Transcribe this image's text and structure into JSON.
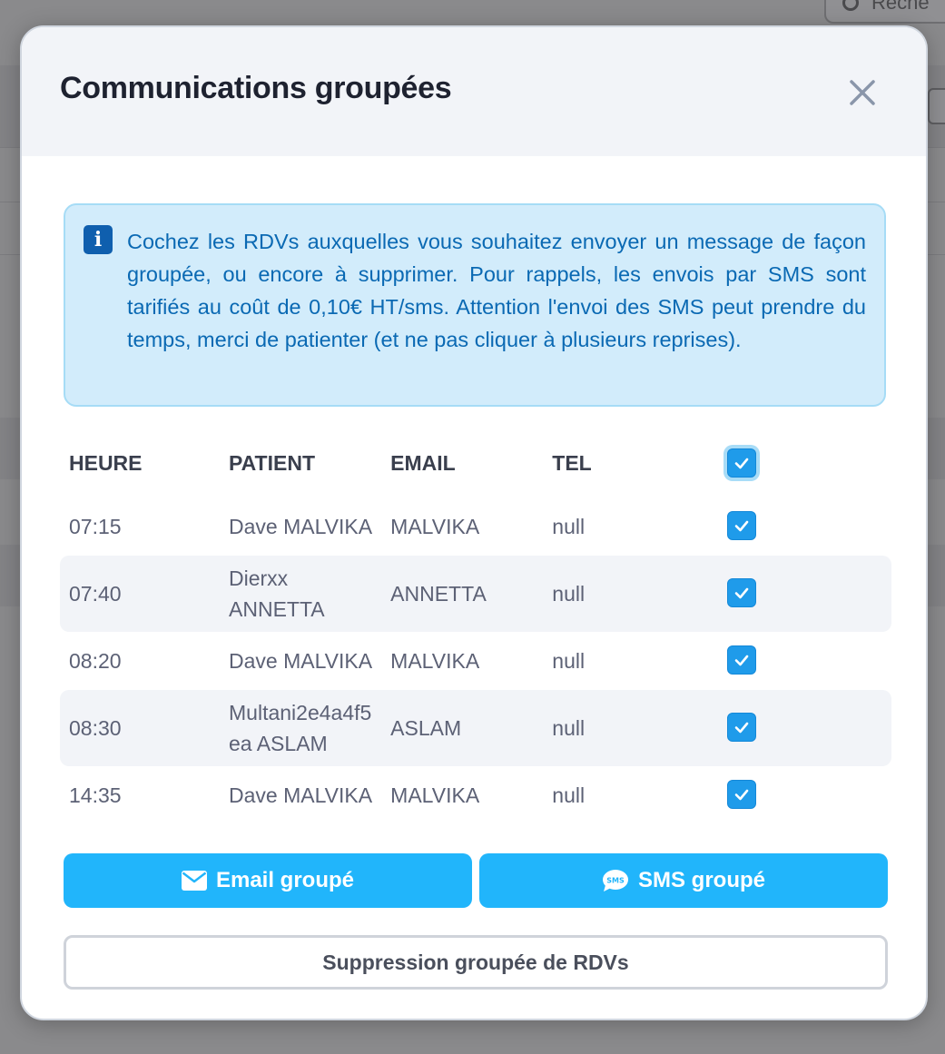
{
  "background": {
    "search_text": "Reche"
  },
  "modal": {
    "title": "Communications groupées",
    "info_text": "Cochez les RDVs auxquelles vous souhaitez envoyer un message de façon groupée, ou encore à supprimer. Pour rappels, les envois par SMS sont tarifiés au coût de 0,10€ HT/sms. Attention l'envoi des SMS peut prendre du temps, merci de patienter (et ne pas cliquer à plusieurs reprises).",
    "table": {
      "headers": {
        "heure": "HEURE",
        "patient": "PATIENT",
        "email": "EMAIL",
        "tel": "TEL"
      },
      "select_all_checked": true,
      "rows": [
        {
          "heure": "07:15",
          "patient": "Dave MALVIKA",
          "email": "MALVIKA",
          "tel": "null",
          "checked": true
        },
        {
          "heure": "07:40",
          "patient": "Dierxx ANNETTA",
          "email": "ANNETTA",
          "tel": "null",
          "checked": true
        },
        {
          "heure": "08:20",
          "patient": "Dave MALVIKA",
          "email": "MALVIKA",
          "tel": "null",
          "checked": true
        },
        {
          "heure": "08:30",
          "patient": "Multani2e4a4f5ea ASLAM",
          "email": "ASLAM",
          "tel": "null",
          "checked": true
        },
        {
          "heure": "14:35",
          "patient": "Dave MALVIKA",
          "email": "MALVIKA",
          "tel": "null",
          "checked": true
        }
      ]
    },
    "buttons": {
      "email": "Email groupé",
      "sms": "SMS groupé",
      "sms_icon_text": "SMS",
      "delete": "Suppression groupée de RDVs"
    },
    "colors": {
      "accent": "#21b5fb",
      "checkbox": "#1f9bea",
      "info_bg": "#d2ecfb",
      "info_text": "#0a69b3"
    }
  }
}
